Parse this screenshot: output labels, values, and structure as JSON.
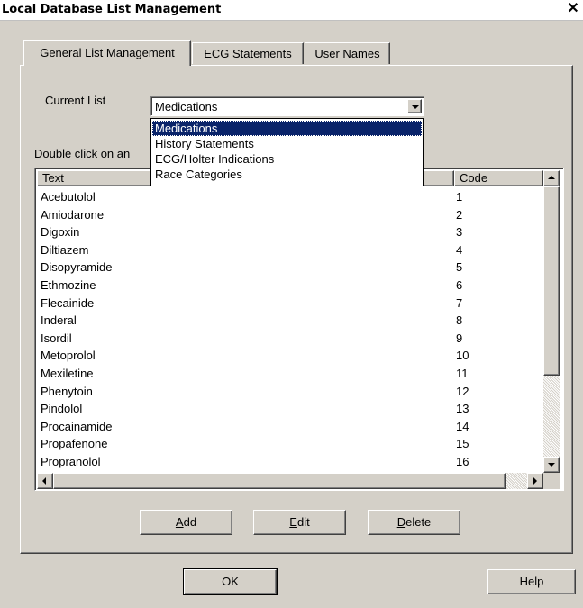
{
  "window": {
    "title": "Local Database List Management",
    "close_glyph": "✕"
  },
  "tabs": [
    {
      "label": "General List Management"
    },
    {
      "label": "ECG Statements"
    },
    {
      "label": "User Names"
    }
  ],
  "current_list": {
    "label": "Current List",
    "value": "Medications",
    "options": [
      "Medications",
      "History Statements",
      "ECG/Holter Indications",
      "Race Categories"
    ]
  },
  "hint": "Double click on an",
  "list": {
    "columns": {
      "text": "Text",
      "code": "Code"
    },
    "rows": [
      {
        "text": "Acebutolol",
        "code": "1"
      },
      {
        "text": "Amiodarone",
        "code": "2"
      },
      {
        "text": "Digoxin",
        "code": "3"
      },
      {
        "text": "Diltiazem",
        "code": "4"
      },
      {
        "text": "Disopyramide",
        "code": "5"
      },
      {
        "text": "Ethmozine",
        "code": "6"
      },
      {
        "text": "Flecainide",
        "code": "7"
      },
      {
        "text": "Inderal",
        "code": "8"
      },
      {
        "text": "Isordil",
        "code": "9"
      },
      {
        "text": "Metoprolol",
        "code": "10"
      },
      {
        "text": "Mexiletine",
        "code": "11"
      },
      {
        "text": "Phenytoin",
        "code": "12"
      },
      {
        "text": "Pindolol",
        "code": "13"
      },
      {
        "text": "Procainamide",
        "code": "14"
      },
      {
        "text": "Propafenone",
        "code": "15"
      },
      {
        "text": "Propranolol",
        "code": "16"
      }
    ]
  },
  "buttons": {
    "add": {
      "mnemonic": "A",
      "rest": "dd"
    },
    "edit": {
      "mnemonic": "E",
      "rest": "dit"
    },
    "delete": {
      "mnemonic": "D",
      "rest": "elete"
    },
    "ok": "OK",
    "help": "Help"
  },
  "colors": {
    "face": "#d4d0c8",
    "selection": "#0a246a"
  }
}
